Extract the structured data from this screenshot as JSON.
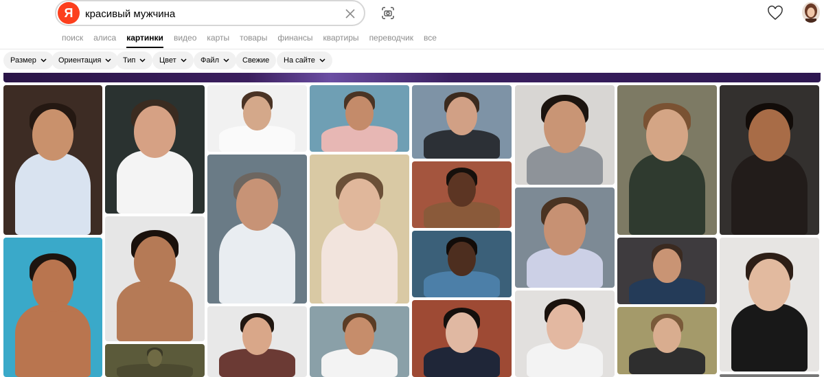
{
  "search": {
    "logo": "Я",
    "query": "красивый мужчина"
  },
  "icons": {
    "clear": "close-icon",
    "camera": "camera-search-icon",
    "favorites": "heart-icon",
    "avatar": "user-avatar"
  },
  "services": [
    {
      "label": "поиск",
      "active": false
    },
    {
      "label": "алиса",
      "active": false
    },
    {
      "label": "картинки",
      "active": true
    },
    {
      "label": "видео",
      "active": false
    },
    {
      "label": "карты",
      "active": false
    },
    {
      "label": "товары",
      "active": false
    },
    {
      "label": "финансы",
      "active": false
    },
    {
      "label": "квартиры",
      "active": false
    },
    {
      "label": "переводчик",
      "active": false
    },
    {
      "label": "все",
      "active": false
    }
  ],
  "filters": [
    {
      "label": "Размер",
      "has_dropdown": true
    },
    {
      "label": "Ориентация",
      "has_dropdown": true
    },
    {
      "label": "Тип",
      "has_dropdown": true
    },
    {
      "label": "Цвет",
      "has_dropdown": true
    },
    {
      "label": "Файл",
      "has_dropdown": true
    },
    {
      "label": "Свежие",
      "has_dropdown": false
    },
    {
      "label": "На сайте",
      "has_dropdown": true
    }
  ],
  "colors": {
    "brand": "#fc3f1d",
    "chip_bg": "#f1f1f1",
    "inactive_text": "#8d8d8d"
  },
  "results": {
    "type": "image-grid",
    "columns": 8
  }
}
